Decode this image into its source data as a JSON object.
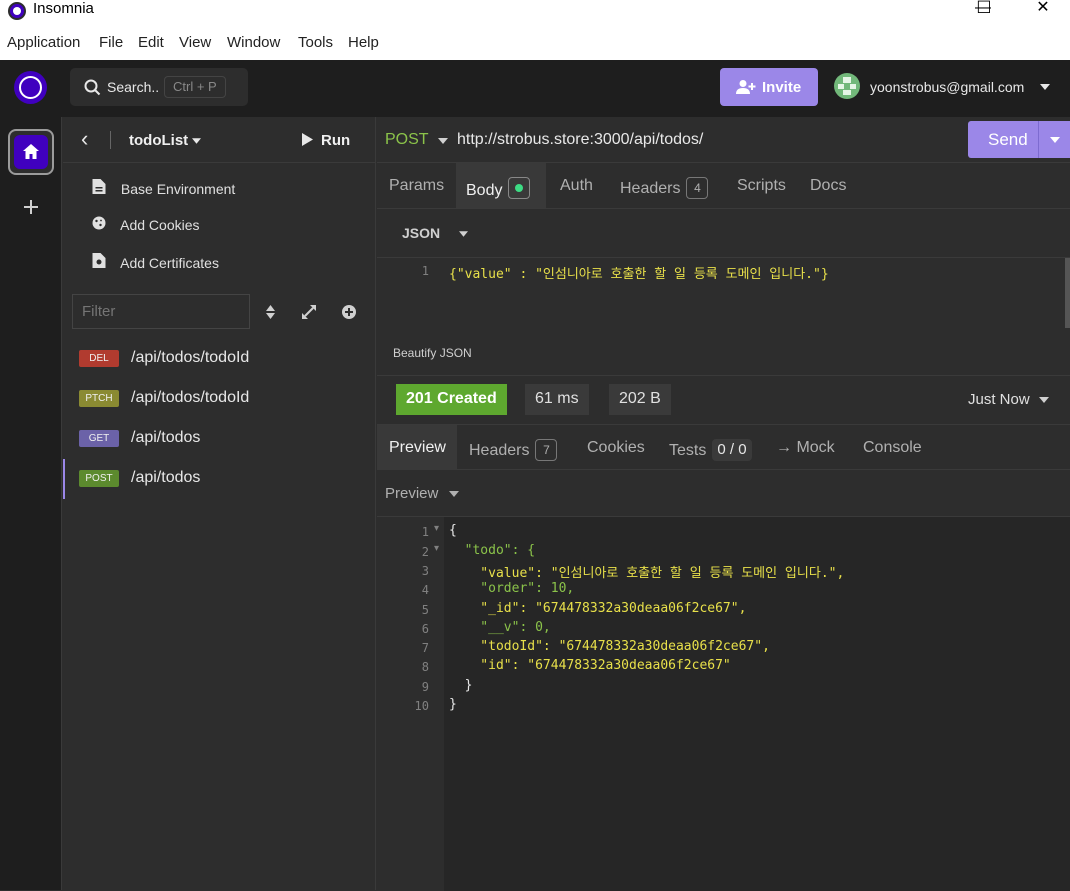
{
  "window": {
    "title": "Insomnia",
    "minimize": "—",
    "maximize": "☐",
    "close": "✕"
  },
  "menu": [
    "Application",
    "File",
    "Edit",
    "View",
    "Window",
    "Tools",
    "Help"
  ],
  "header": {
    "search_label": "Search..",
    "search_shortcut": "Ctrl + P",
    "invite_label": "Invite",
    "user_email": "yoonstrobus@gmail.com"
  },
  "sidebar": {
    "back": "‹",
    "project_name": "todoList",
    "run_label": "Run",
    "links": [
      {
        "label": "Base Environment",
        "icon": "file-icon"
      },
      {
        "label": "Add Cookies",
        "icon": "cookie-icon"
      },
      {
        "label": "Add Certificates",
        "icon": "certificate-icon"
      }
    ],
    "filter_placeholder": "Filter",
    "requests": [
      {
        "method": "DEL",
        "path": "/api/todos/todoId",
        "color": "#b13b2f"
      },
      {
        "method": "PTCH",
        "path": "/api/todos/todoId",
        "color": "#8a8a32"
      },
      {
        "method": "GET",
        "path": "/api/todos",
        "color": "#6b62a8"
      },
      {
        "method": "POST",
        "path": "/api/todos",
        "color": "#5c8a2e",
        "active": true
      }
    ]
  },
  "request": {
    "method": "POST",
    "url": "http://strobus.store:3000/api/todos/",
    "send_label": "Send",
    "tabs": [
      {
        "label": "Params"
      },
      {
        "label": "Body",
        "active": true
      },
      {
        "label": "Auth"
      },
      {
        "label": "Headers",
        "count": "4"
      },
      {
        "label": "Scripts"
      },
      {
        "label": "Docs"
      }
    ],
    "body_type": "JSON",
    "body_line_no": "1",
    "body_text": "{\"value\" : \"인섬니아로 호출한 할 일 등록 도메인 입니다.\"}",
    "beautify_label": "Beautify JSON"
  },
  "response": {
    "status": "201 Created",
    "status_color": "#5ea82f",
    "time": "61 ms",
    "size": "202 B",
    "when": "Just Now",
    "tabs": [
      {
        "label": "Preview",
        "active": true
      },
      {
        "label": "Headers",
        "count": "7"
      },
      {
        "label": "Cookies"
      },
      {
        "label": "Tests",
        "count": "0 / 0"
      },
      {
        "label": "→ Mock"
      },
      {
        "label": "Console"
      }
    ],
    "preview_mode": "Preview",
    "lines": [
      {
        "n": "1",
        "fold": "▾",
        "text": "{"
      },
      {
        "n": "2",
        "fold": "▾",
        "text": "  \"todo\": {"
      },
      {
        "n": "3",
        "text": "    \"value\": \"인섬니아로 호출한 할 일 등록 도메인 입니다.\","
      },
      {
        "n": "4",
        "text": "    \"order\": 10,"
      },
      {
        "n": "5",
        "text": "    \"_id\": \"674478332a30deaa06f2ce67\","
      },
      {
        "n": "6",
        "text": "    \"__v\": 0,"
      },
      {
        "n": "7",
        "text": "    \"todoId\": \"674478332a30deaa06f2ce67\","
      },
      {
        "n": "8",
        "text": "    \"id\": \"674478332a30deaa06f2ce67\""
      },
      {
        "n": "9",
        "text": "  }"
      },
      {
        "n": "10",
        "text": "}"
      }
    ]
  }
}
